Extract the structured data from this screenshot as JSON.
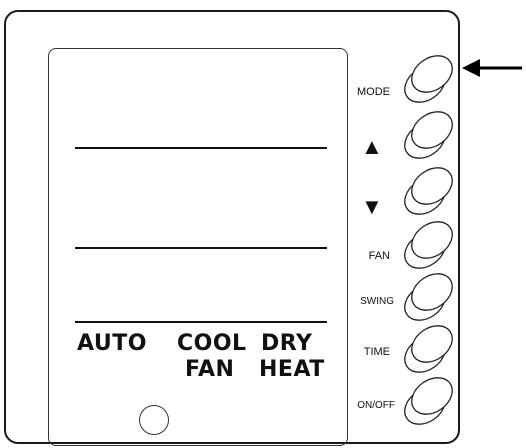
{
  "display": {
    "mode_labels_row1": [
      "AUTO",
      "COOL",
      "DRY"
    ],
    "mode_labels_row2": [
      "FAN",
      "HEAT"
    ]
  },
  "buttons": [
    {
      "name": "mode",
      "label": "MODE",
      "icon": ""
    },
    {
      "name": "up",
      "label": "",
      "icon": "up-triangle-icon"
    },
    {
      "name": "down",
      "label": "",
      "icon": "down-triangle-icon"
    },
    {
      "name": "fan",
      "label": "FAN",
      "icon": ""
    },
    {
      "name": "swing",
      "label": "SWING",
      "icon": ""
    },
    {
      "name": "time",
      "label": "TIME",
      "icon": ""
    },
    {
      "name": "onoff",
      "label": "ON/OFF",
      "icon": ""
    }
  ],
  "pointer_arrow": {
    "target": "mode",
    "icon": "left-arrow-icon"
  }
}
